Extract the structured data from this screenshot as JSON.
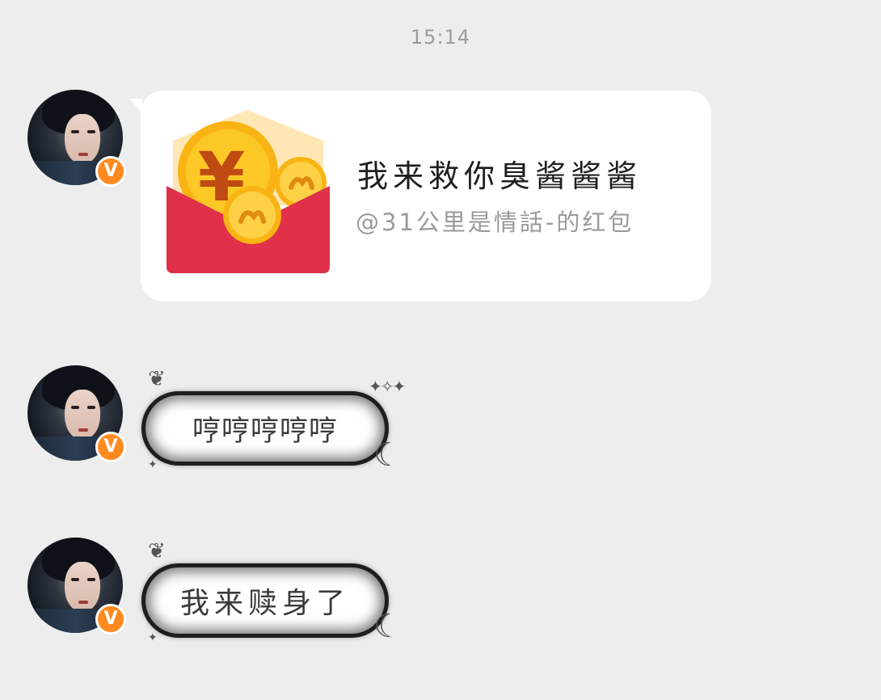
{
  "timestamp": "15:14",
  "avatar_badge": "V",
  "messages": [
    {
      "type": "red_packet",
      "title": "我来救你臭酱酱酱",
      "subtitle": "@31公里是情話-的红包",
      "currency_symbol": "¥",
      "envelope_color": "#e0304a",
      "coin_color": "#fbc51a"
    },
    {
      "type": "text",
      "text": "哼哼哼哼哼"
    },
    {
      "type": "text",
      "text": "我来赎身了"
    }
  ],
  "colors": {
    "background": "#ededed",
    "bubble": "#ffffff",
    "badge": "#ff8a1f"
  }
}
